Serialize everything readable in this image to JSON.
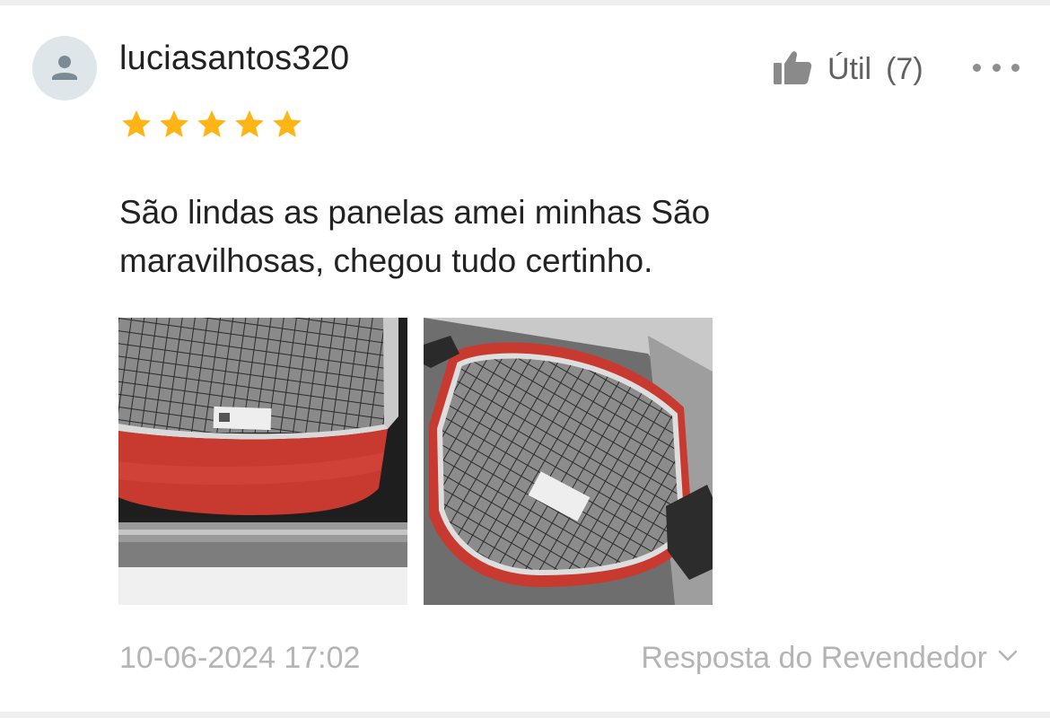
{
  "review": {
    "username": "luciasantos320",
    "rating": 5,
    "rating_max": 5,
    "text": "São lindas as panelas amei minhas São maravilhosas, chegou tudo certinho.",
    "helpful_label": "Útil",
    "helpful_count": "(7)",
    "timestamp": "10-06-2024 17:02",
    "seller_reply_label": "Resposta do Revendedor",
    "photos": [
      {
        "name": "review-photo-1"
      },
      {
        "name": "review-photo-2"
      }
    ]
  },
  "colors": {
    "star": "#ffb516",
    "text_primary": "#222222",
    "text_secondary": "#606060",
    "text_muted": "#b4b4b4",
    "avatar_bg": "#dfe6ea",
    "avatar_icon": "#7a8b96",
    "pan_red": "#c8392f"
  },
  "icons": {
    "avatar": "person-icon",
    "helpful": "thumbs-up-icon",
    "more": "more-dots-icon",
    "seller_reply": "chevron-down-icon",
    "star": "star-icon"
  }
}
